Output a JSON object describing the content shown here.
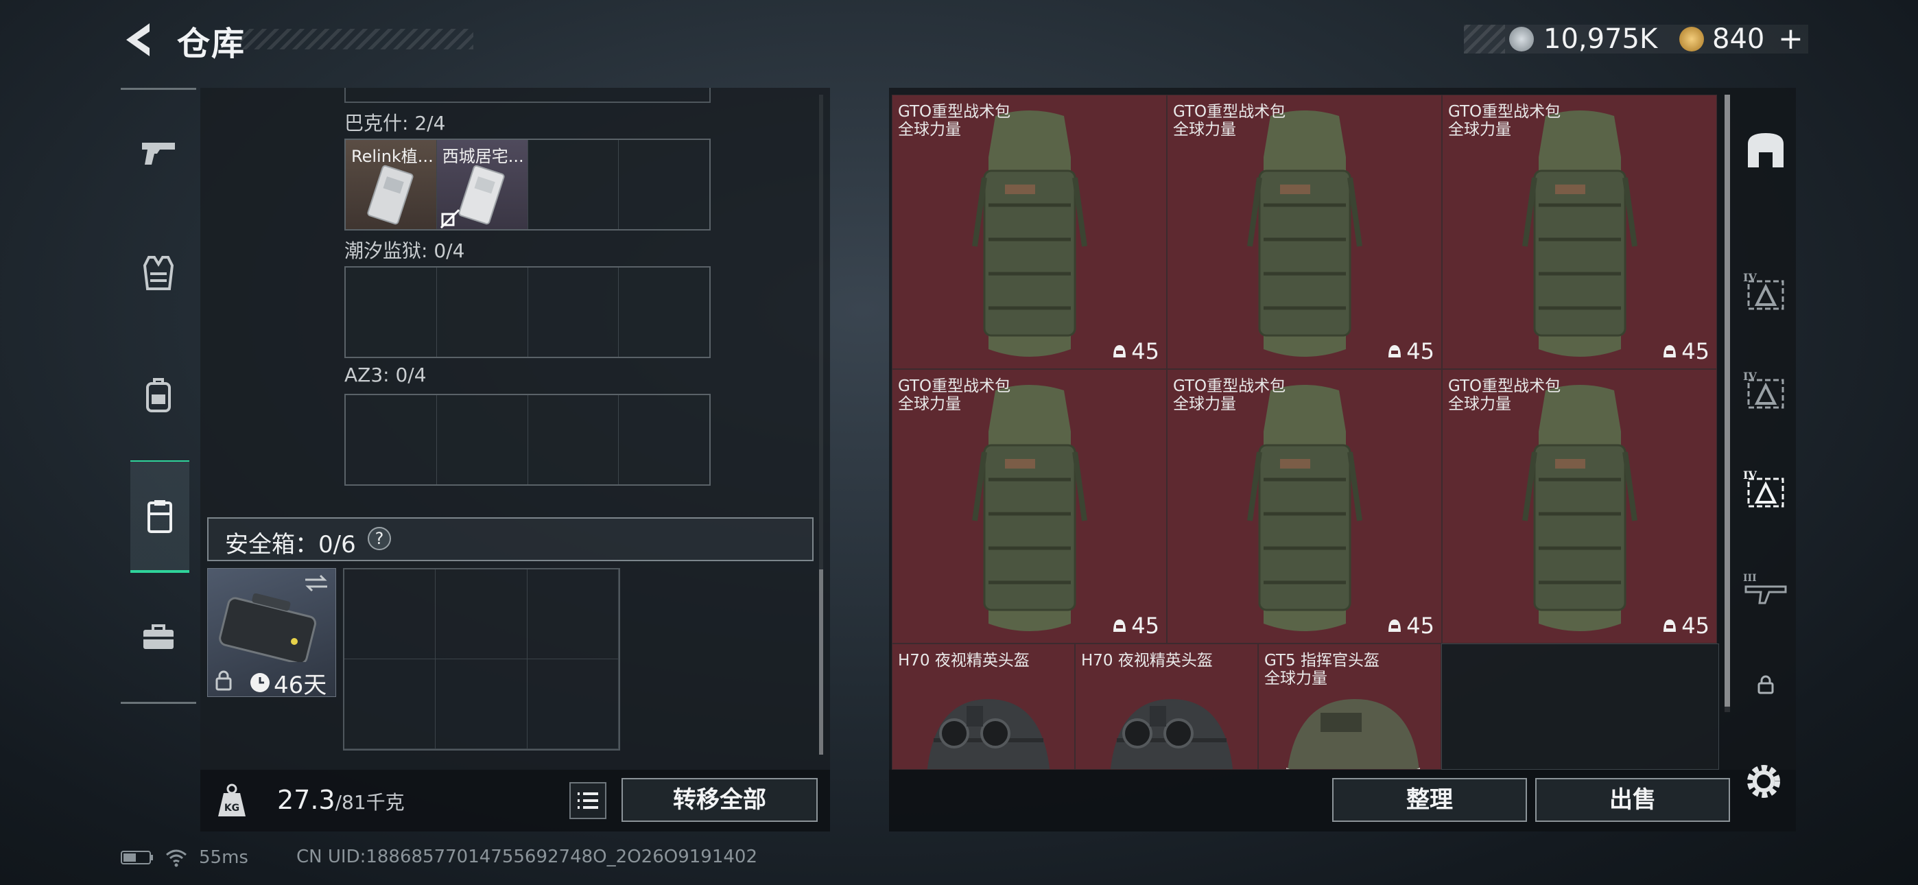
{
  "header": {
    "title": "仓库",
    "currency": [
      {
        "name": "silver-coin-icon",
        "value": "10,975K",
        "color": "#b9c0c6"
      },
      {
        "name": "gold-coin-icon",
        "value": "840",
        "color": "#d9a441"
      }
    ],
    "add_symbol": "+"
  },
  "nav": {
    "items": [
      {
        "icon": "pistol-icon",
        "active": false
      },
      {
        "icon": "vest-icon",
        "active": false
      },
      {
        "icon": "backpack-icon",
        "active": false
      },
      {
        "icon": "clipboard-icon",
        "active": true
      },
      {
        "icon": "toolbox-icon",
        "active": false
      }
    ],
    "active_color": "#2fd39a"
  },
  "left": {
    "sections": [
      {
        "label": "巴克什: 2/4",
        "items": [
          "Relink植...",
          "西城居宅..."
        ]
      },
      {
        "label": "潮汐监狱: 0/4",
        "items": []
      },
      {
        "label": "AZ3: 0/4",
        "items": []
      }
    ],
    "safe": {
      "label": "安全箱：0/6",
      "help": "?",
      "days": "46天"
    },
    "weight_current": "27.3",
    "weight_max": "/81千克",
    "weight_icon_text": "KG",
    "transfer_label": "转移全部"
  },
  "right": {
    "items": [
      {
        "name": "GTO重型战术包",
        "sub": "全球力量",
        "durability": "45"
      },
      {
        "name": "GTO重型战术包",
        "sub": "全球力量",
        "durability": "45"
      },
      {
        "name": "GTO重型战术包",
        "sub": "全球力量",
        "durability": "45"
      },
      {
        "name": "GTO重型战术包",
        "sub": "全球力量",
        "durability": "45"
      },
      {
        "name": "GTO重型战术包",
        "sub": "全球力量",
        "durability": "45"
      },
      {
        "name": "GTO重型战术包",
        "sub": "全球力量",
        "durability": "45"
      }
    ],
    "helmets": [
      {
        "name": "H70 夜视精英头盔",
        "sub": ""
      },
      {
        "name": "H70 夜视精英头盔",
        "sub": ""
      },
      {
        "name": "GT5 指挥官头盔",
        "sub": "全球力量"
      }
    ],
    "item_bg_color": "#5e2930",
    "sort_label": "整理",
    "sell_label": "出售",
    "tabs": [
      {
        "icon": "armor-icon",
        "tier": ""
      },
      {
        "icon": "backpack-tier-icon",
        "tier": "IV"
      },
      {
        "icon": "backpack-tier-icon",
        "tier": "IV"
      },
      {
        "icon": "backpack-tier-icon",
        "tier": "IV"
      },
      {
        "icon": "rifle-tier-icon",
        "tier": "III"
      },
      {
        "icon": "lock-icon",
        "tier": ""
      }
    ]
  },
  "status": {
    "ping": "55ms",
    "uid": "CN UID:18868577014755692748O_2O26O9191402"
  }
}
